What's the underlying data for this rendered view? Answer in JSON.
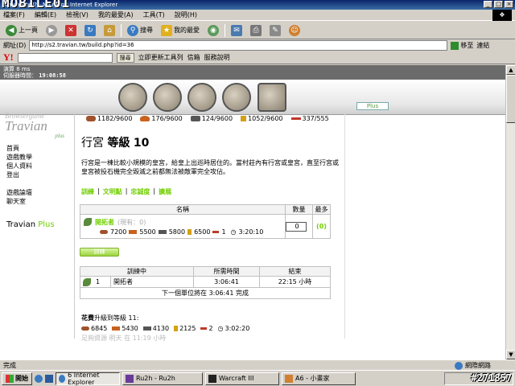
{
  "window": {
    "title": "Travian.tw/? - Microsoft Internet Explorer",
    "watermark": "MOBILE01"
  },
  "menubar": [
    "檔案(F)",
    "編輯(E)",
    "檢視(V)",
    "我的最愛(A)",
    "工具(T)",
    "說明(H)"
  ],
  "toolbar": {
    "back": "上一頁",
    "search": "搜尋",
    "favorites": "我的最愛"
  },
  "addressbar": {
    "label": "網址(D)",
    "url": "http://s2.travian.tw/build.php?id=36",
    "go": "移至",
    "links": "連結"
  },
  "yahoobar": {
    "logo": "Y!",
    "search_btn": "搜尋",
    "update_btn": "立即更新工具列",
    "mail": "信箱",
    "help": "服務說明"
  },
  "game": {
    "ping": "演算 8 ms",
    "server_time_label": "伺服器時間：",
    "server_time": "19:08:58",
    "plus_button": "Plus",
    "logo": {
      "line1": "Browsergame",
      "line2": "Travian",
      "line3": "plus"
    },
    "sidemenu": [
      "首頁",
      "遊戲教學",
      "個人資料",
      "登出",
      "遊戲論壇",
      "聊天室"
    ],
    "travian_plus": {
      "prefix": "Travian ",
      "plus": "Plus"
    },
    "resources": [
      {
        "icon": "wood-icon",
        "text": "1182/9600",
        "color": "#a0522d"
      },
      {
        "icon": "clay-icon",
        "text": "176/9600",
        "color": "#c8621c"
      },
      {
        "icon": "iron-icon",
        "text": "124/9600",
        "color": "#555555"
      },
      {
        "icon": "crop-icon",
        "text": "1052/9600",
        "color": "#d4a017"
      },
      {
        "icon": "crop-consumption-icon",
        "text": "337/555",
        "color": "#c0392b"
      }
    ],
    "building": {
      "name": "行宮",
      "level_label": "等級",
      "level": "10",
      "description": "行宮是一棟比較小規模的皇宮，給皇上出巡時居住的。當村莊內有行宮或皇宮，直至行宮或皇宮被投石機完全毀滅之前都無法被敵軍完全攻佔。"
    },
    "tabs": [
      "訓練",
      "文明點",
      "忠誠度",
      "擴展"
    ],
    "train_table": {
      "headers": [
        "名稱",
        "數量",
        "最多"
      ],
      "unit_name": "開拓者",
      "unit_own": "(現有：0)",
      "costs": [
        "7200",
        "5500",
        "5800",
        "6500",
        "1"
      ],
      "time": "3:20:10",
      "qty": "0",
      "max": "(0)"
    },
    "train_button": "訓練",
    "queue_table": {
      "headers": [
        "訓練中",
        "所需時間",
        "結束"
      ],
      "count": "1",
      "unit": "開拓者",
      "duration": "3:06:41",
      "end": "22:15 小時",
      "next_unit": "下一個單位將在 3:06:41 完成"
    },
    "upgrade": {
      "title": "花費",
      "title_rest": "升級到等級 11:",
      "costs": [
        "6845",
        "5430",
        "4130",
        "2125",
        "2"
      ],
      "time": "3:02:20",
      "note": "足夠資源 明天 在 11:19 小時"
    }
  },
  "statusbar": {
    "text": "完成",
    "zone": "網際網路"
  },
  "taskbar": {
    "start": "開始",
    "tasks": [
      "6 Internet Explorer",
      "Ru2h - Ru2h",
      "Warcraft III",
      "A6 - 小畫家"
    ],
    "stamp": "#271857"
  }
}
